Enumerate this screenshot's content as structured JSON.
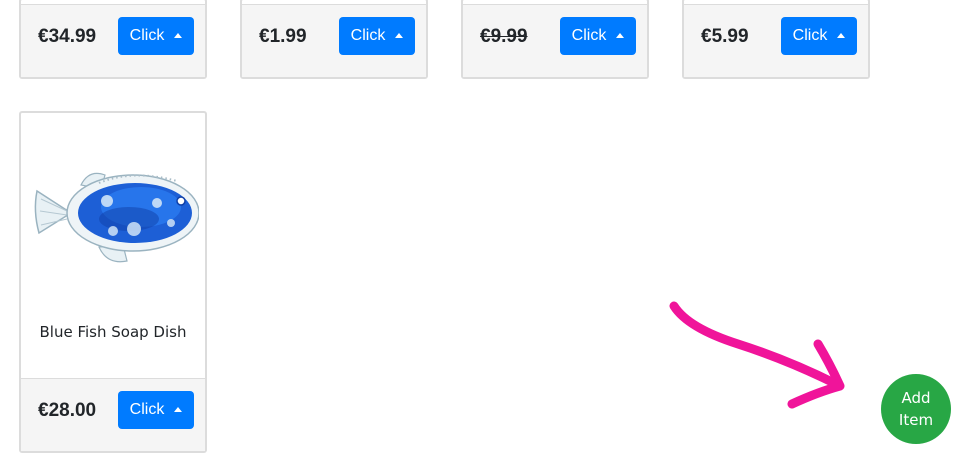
{
  "products": [
    {
      "price": "€34.99",
      "struck": false,
      "button_label": "Click"
    },
    {
      "price": "€1.99",
      "struck": false,
      "button_label": "Click"
    },
    {
      "price": "€9.99",
      "struck": true,
      "button_label": "Click"
    },
    {
      "price": "€5.99",
      "struck": false,
      "button_label": "Click"
    },
    {
      "name": "Blue Fish Soap Dish",
      "price": "€28.00",
      "struck": false,
      "button_label": "Click"
    }
  ],
  "fab": {
    "line1": "Add",
    "line2": "Item"
  },
  "colors": {
    "primary_button": "#007bff",
    "add_button": "#28a745",
    "annotation_arrow": "#f0149a",
    "card_border": "#dcdcdc",
    "card_footer": "#f5f5f5"
  },
  "icons": {
    "dropdown": "caret-up-icon",
    "annotation": "arrow-annotation-icon",
    "product_image": "blue-fish-soap-dish-image"
  }
}
